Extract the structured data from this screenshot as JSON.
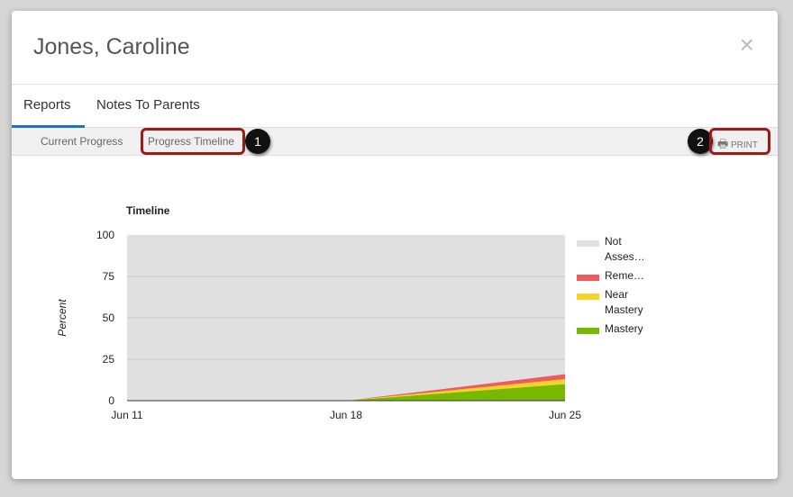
{
  "modal": {
    "title": "Jones, Caroline",
    "close": "×"
  },
  "tabs": [
    {
      "label": "Reports"
    },
    {
      "label": "Notes To Parents"
    }
  ],
  "subtabs": [
    {
      "label": "Current Progress"
    },
    {
      "label": "Progress Timeline"
    }
  ],
  "print_label": "PRINT",
  "callouts": [
    "1",
    "2"
  ],
  "chart_data": {
    "type": "area",
    "title": "Timeline",
    "ylabel": "Percent",
    "xlabel": "",
    "x": [
      "Jun 11",
      "Jun 18",
      "Jun 25"
    ],
    "ylim": [
      0,
      100
    ],
    "yticks": [
      "0",
      "25",
      "50",
      "75",
      "100"
    ],
    "stacked": true,
    "series": [
      {
        "name": "Mastery",
        "color": "#77b800",
        "values": [
          0,
          0,
          10
        ]
      },
      {
        "name": "Near Mastery",
        "color": "#f5d327",
        "values": [
          0,
          0,
          3
        ]
      },
      {
        "name": "Reme…",
        "color": "#ef5b5b",
        "values": [
          0,
          0,
          3
        ]
      },
      {
        "name": "Not Asses…",
        "color": "#e0e0e0",
        "values": [
          100,
          100,
          84
        ]
      }
    ],
    "legend": [
      {
        "lines": [
          "Not",
          "Asses…"
        ],
        "color": "#e0e0e0"
      },
      {
        "lines": [
          "Reme…"
        ],
        "color": "#ef5b5b"
      },
      {
        "lines": [
          "Near",
          "Mastery"
        ],
        "color": "#f5d327"
      },
      {
        "lines": [
          "Mastery"
        ],
        "color": "#77b800"
      }
    ],
    "legend_position": "right"
  }
}
